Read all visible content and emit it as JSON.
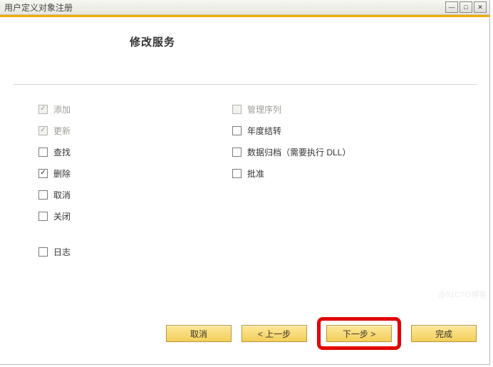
{
  "window": {
    "title": "用户定义对象注册"
  },
  "heading": "修改服务",
  "checkboxes": {
    "left": [
      {
        "key": "add",
        "label": "添加",
        "checked": true,
        "disabled": true
      },
      {
        "key": "update",
        "label": "更新",
        "checked": true,
        "disabled": true
      },
      {
        "key": "find",
        "label": "查找",
        "checked": false,
        "disabled": false
      },
      {
        "key": "delete",
        "label": "删除",
        "checked": true,
        "disabled": false
      },
      {
        "key": "cancel",
        "label": "取消",
        "checked": false,
        "disabled": false
      },
      {
        "key": "close",
        "label": "关闭",
        "checked": false,
        "disabled": false
      }
    ],
    "log": {
      "key": "log",
      "label": "日志",
      "checked": false,
      "disabled": false
    },
    "right": [
      {
        "key": "manage_series",
        "label": "管理序列",
        "checked": false,
        "disabled": true
      },
      {
        "key": "year_transfer",
        "label": "年度结转",
        "checked": false,
        "disabled": false
      },
      {
        "key": "archive",
        "label": "数据归档（需要执行 DLL）",
        "checked": false,
        "disabled": false
      },
      {
        "key": "approve",
        "label": "批准",
        "checked": false,
        "disabled": false
      }
    ]
  },
  "buttons": {
    "cancel": "取消",
    "back": "< 上一步",
    "next": "下一步 >",
    "finish": "完成"
  },
  "watermark": "@51CTO博客"
}
